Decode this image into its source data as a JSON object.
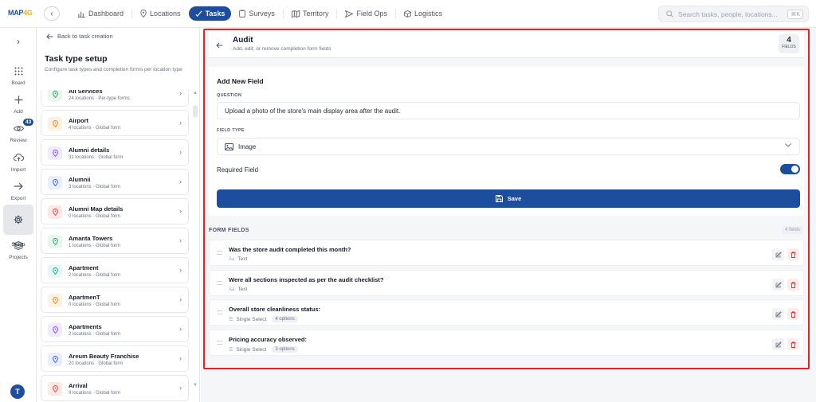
{
  "app": {
    "logo_text_main": "MAP",
    "logo_text_accent": "4G"
  },
  "topnav": {
    "items": [
      {
        "label": "Dashboard",
        "icon": "bar-chart-icon",
        "active": false
      },
      {
        "label": "Locations",
        "icon": "map-pin-icon",
        "active": false
      },
      {
        "label": "Tasks",
        "icon": "checklist-icon",
        "active": true
      },
      {
        "label": "Surveys",
        "icon": "clipboard-icon",
        "active": false
      },
      {
        "label": "Territory",
        "icon": "map-icon",
        "active": false
      },
      {
        "label": "Field Ops",
        "icon": "send-icon",
        "active": false
      },
      {
        "label": "Logistics",
        "icon": "box-icon",
        "active": false
      }
    ],
    "search_placeholder": "Search tasks, people, locations...",
    "search_shortcut": "⌘K"
  },
  "rail": {
    "items": [
      {
        "label": "Board",
        "icon": "grid-icon"
      },
      {
        "label": "Add",
        "icon": "plus-icon"
      },
      {
        "label": "Review",
        "icon": "eye-icon",
        "badge": "43"
      },
      {
        "label": "Import",
        "icon": "cloud-upload-icon"
      },
      {
        "label": "Export",
        "icon": "arrow-right-icon"
      },
      {
        "label": "Setup",
        "icon": "gear-icon",
        "active": true
      },
      {
        "label": "Projects",
        "icon": "layers-icon"
      }
    ],
    "avatar_initial": "T"
  },
  "panel": {
    "back_label": "Back to task creation",
    "title": "Task type setup",
    "subtitle": "Configure task types and completion forms per location type",
    "items": [
      {
        "name": "All Services",
        "meta": "24 locations · Per-type forms",
        "color": "#e7f7ee",
        "pin": "#2f9e5f"
      },
      {
        "name": "Airport",
        "meta": "4 locations · Global form",
        "color": "#fdf1e2",
        "pin": "#e08a1c"
      },
      {
        "name": "Alumni details",
        "meta": "31 locations · Global form",
        "color": "#f0eafd",
        "pin": "#7c4ddc"
      },
      {
        "name": "Alumnii",
        "meta": "3 locations · Global form",
        "color": "#e8eefc",
        "pin": "#3b66d1"
      },
      {
        "name": "Alumni Map details",
        "meta": "0 locations · Global form",
        "color": "#fde8e8",
        "pin": "#d9463a"
      },
      {
        "name": "Amanta Towers",
        "meta": "1 locations · Global form",
        "color": "#e7f7ee",
        "pin": "#2f9e5f"
      },
      {
        "name": "Apartment",
        "meta": "2 locations · Global form",
        "color": "#e6f6f4",
        "pin": "#1f9c8a"
      },
      {
        "name": "ApartmenT",
        "meta": "0 locations · Global form",
        "color": "#fdf1e2",
        "pin": "#e08a1c"
      },
      {
        "name": "Apartments",
        "meta": "2 locations · Global form",
        "color": "#f0eafd",
        "pin": "#7c4ddc"
      },
      {
        "name": "Areum Beauty Franchise",
        "meta": "20 locations · Global form",
        "color": "#e8eefc",
        "pin": "#3b66d1"
      },
      {
        "name": "Arrival",
        "meta": "9 locations · Global form",
        "color": "#fde8e8",
        "pin": "#d9463a"
      }
    ]
  },
  "detail": {
    "title": "Audit",
    "subtitle": "Add, edit, or remove completion form fields",
    "fields_count": "4",
    "fields_label": "FIELDS"
  },
  "add_field": {
    "title": "Add New Field",
    "question_label": "QUESTION",
    "question_value": "Upload a photo of the store's main display area after the audit.",
    "type_label": "FIELD TYPE",
    "type_value": "Image",
    "required_label": "Required Field",
    "required_on": true,
    "save_label": "Save"
  },
  "form_fields": {
    "title": "FORM FIELDS",
    "count_label": "4 fields",
    "items": [
      {
        "question": "Was the store audit completed this month?",
        "type": "Text",
        "type_icon": "Aa",
        "options": ""
      },
      {
        "question": "Were all sections inspected as per the audit checklist?",
        "type": "Text",
        "type_icon": "Aa",
        "options": ""
      },
      {
        "question": "Overall store cleanliness status:",
        "type": "Single Select",
        "type_icon": "☰",
        "options": "4 options"
      },
      {
        "question": "Pricing accuracy observed:",
        "type": "Single Select",
        "type_icon": "☰",
        "options": "3 options"
      }
    ]
  },
  "colors": {
    "primary": "#1d4e9e",
    "accent": "#f2b01e",
    "highlight_frame": "#e02424"
  }
}
